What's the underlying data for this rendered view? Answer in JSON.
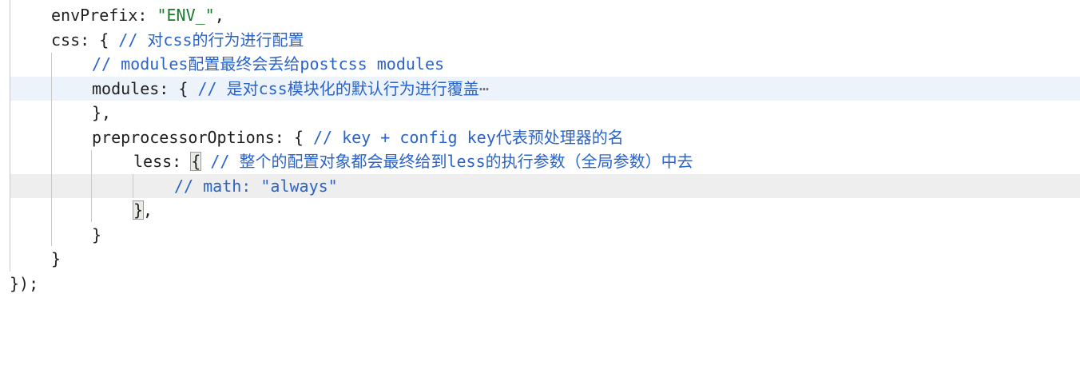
{
  "code_lines": [
    {
      "prop": "envPrefix",
      "sep": ": ",
      "str": "\"ENV_\"",
      "tail": ","
    },
    {
      "prop": "css",
      "sep": ": { ",
      "comment": "// 对css的行为进行配置"
    },
    {
      "comment": "// modules配置最终会丢给postcss modules"
    },
    {
      "prop": "modules",
      "sep": ": { ",
      "comment": "// 是对css模块化的默认行为进行覆盖",
      "folded": "⋯"
    },
    {
      "punct": "},"
    },
    {
      "prop": "preprocessorOptions",
      "sep": ": { ",
      "comment": "// key + config key代表预处理器的名"
    },
    {
      "prop": "less",
      "sep": ": ",
      "brace": "{",
      "comment": " // 整个的配置对象都会最终给到less的执行参数（全局参数）中去"
    },
    {
      "comment": "// math: \"always\""
    },
    {
      "brace": "}",
      "punct": ","
    },
    {
      "punct": "}"
    },
    {
      "punct": "}"
    },
    {
      "punct": "});"
    }
  ]
}
